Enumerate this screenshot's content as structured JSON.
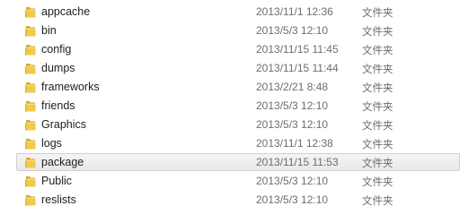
{
  "colors": {
    "selection_bg": "#ececec",
    "folder_yellow": "#f2c94a",
    "folder_dark": "#d9a72a",
    "meta_text": "#6d6d6d"
  },
  "folder_icon": "folder-icon",
  "selected_index": 8,
  "items": [
    {
      "name": "appcache",
      "date": "2013/11/1 12:36",
      "type": "文件夹"
    },
    {
      "name": "bin",
      "date": "2013/5/3 12:10",
      "type": "文件夹"
    },
    {
      "name": "config",
      "date": "2013/11/15 11:45",
      "type": "文件夹"
    },
    {
      "name": "dumps",
      "date": "2013/11/15 11:44",
      "type": "文件夹"
    },
    {
      "name": "frameworks",
      "date": "2013/2/21 8:48",
      "type": "文件夹"
    },
    {
      "name": "friends",
      "date": "2013/5/3 12:10",
      "type": "文件夹"
    },
    {
      "name": "Graphics",
      "date": "2013/5/3 12:10",
      "type": "文件夹"
    },
    {
      "name": "logs",
      "date": "2013/11/1 12:38",
      "type": "文件夹"
    },
    {
      "name": "package",
      "date": "2013/11/15 11:53",
      "type": "文件夹"
    },
    {
      "name": "Public",
      "date": "2013/5/3 12:10",
      "type": "文件夹"
    },
    {
      "name": "reslists",
      "date": "2013/5/3 12:10",
      "type": "文件夹"
    }
  ]
}
